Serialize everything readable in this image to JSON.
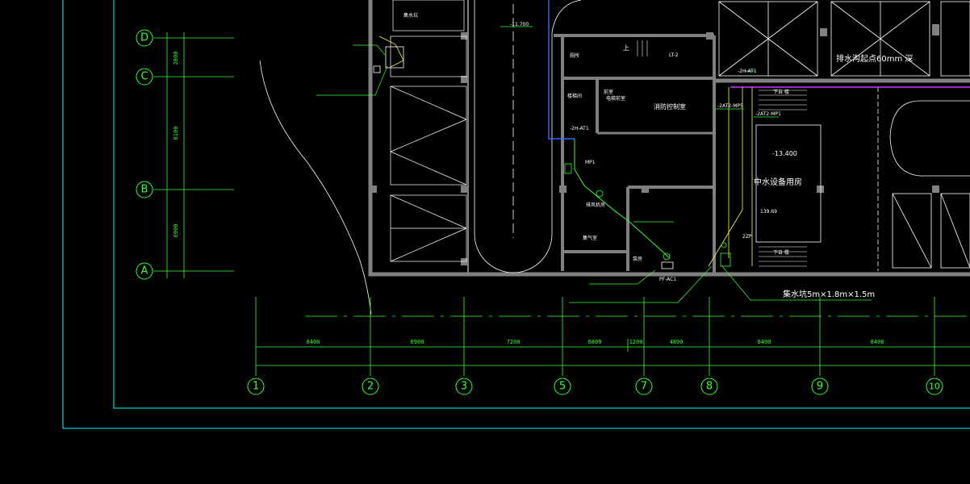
{
  "drawing": {
    "colors": {
      "background": "#000000",
      "frame": "#00ffff",
      "axis": "#33ff33",
      "wall": "#808080",
      "linework": "#ffffff",
      "pipe_magenta": "#cc33ff",
      "pipe_blue": "#3366ff",
      "leader_yellow": "#ffff33"
    },
    "vertical_axes": [
      "1",
      "2",
      "3",
      "5",
      "7",
      "8",
      "9",
      "10"
    ],
    "horizontal_axes": [
      "D",
      "C",
      "B",
      "A"
    ],
    "bay_dimensions": [
      "8400",
      "6900",
      "7200",
      "6800",
      "1200",
      "4800",
      "8400",
      "8400"
    ],
    "row_dimensions": [
      "2800",
      "8100",
      "6900"
    ],
    "labels": {
      "sump_pit": "集水坑5m×1.8m×1.5m",
      "drain_channel": "排水沟起点60mm 深",
      "reclaimed_room": "中水设备用房",
      "elev_main": "-13.400",
      "elev_ramp": "-11.700",
      "area_room": "139.69",
      "fire_control": "消防控制室",
      "stair": "楼梯间",
      "fan_room": "排风机房",
      "gas_room": "集气室",
      "pump_room": "泵房",
      "toilet": "厕所",
      "well_room": "前室",
      "elev_lobby": "电梯前室",
      "lift": "LT-2",
      "up": "上",
      "down_left": "下自 楼",
      "down_right": "下自 楼",
      "sump_small": "集水坑",
      "pipe_2p": "2ZP",
      "pipe_note_1": "-2H-AT1",
      "pipe_note_2": "-2AT2-MP5",
      "pipe_note_3": "-2AT2-MP1",
      "pipe_note_4": "-2H-AT1",
      "mp1": "MP1",
      "pf": "PF-AC1"
    }
  }
}
